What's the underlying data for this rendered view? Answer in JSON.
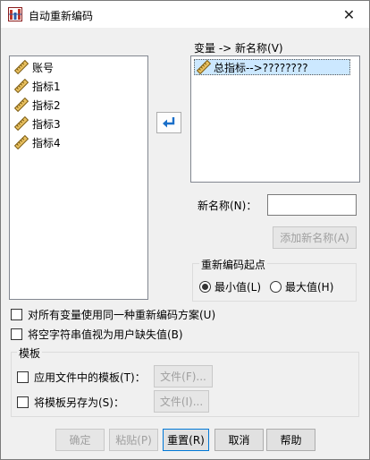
{
  "window": {
    "title": "自动重新编码"
  },
  "source_list": {
    "items": [
      {
        "label": "账号",
        "icon": "ruler-icon"
      },
      {
        "label": "指标1",
        "icon": "ruler-icon"
      },
      {
        "label": "指标2",
        "icon": "ruler-icon"
      },
      {
        "label": "指标3",
        "icon": "ruler-icon"
      },
      {
        "label": "指标4",
        "icon": "ruler-icon"
      }
    ]
  },
  "target": {
    "header": "变量 -> 新名称(V)",
    "items": [
      {
        "label": "总指标-->????????",
        "icon": "ruler-icon"
      }
    ]
  },
  "new_name": {
    "label": "新名称(N)：",
    "value": "",
    "add_button": "添加新名称(A)"
  },
  "recode_start": {
    "legend": "重新编码起点",
    "options": [
      {
        "label": "最小值(L)",
        "selected": true
      },
      {
        "label": "最大值(H)",
        "selected": false
      }
    ]
  },
  "options": {
    "same_scheme": {
      "label": "对所有变量使用同一种重新编码方案(U)",
      "checked": false
    },
    "blank_missing": {
      "label": "将空字符串值视为用户缺失值(B)",
      "checked": false
    }
  },
  "template": {
    "legend": "模板",
    "apply": {
      "label": "应用文件中的模板(T)：",
      "checked": false,
      "file_button": "文件(F)..."
    },
    "save": {
      "label": "将模板另存为(S)：",
      "checked": false,
      "file_button": "文件(I)..."
    }
  },
  "buttons": {
    "ok": "确定",
    "paste": "粘贴(P)",
    "reset": "重置(R)",
    "cancel": "取消",
    "help": "帮助"
  },
  "colors": {
    "selection": "#cce8ff",
    "focus_border": "#0078d7",
    "arrow_icon": "#1a6fc9"
  }
}
